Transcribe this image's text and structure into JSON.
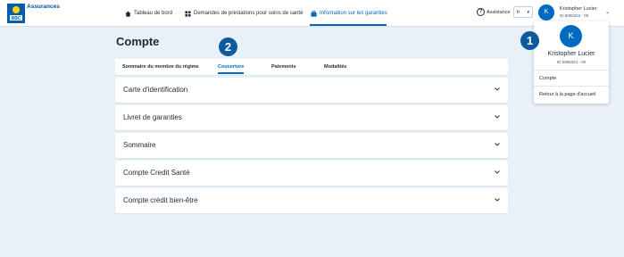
{
  "brand": {
    "name": "Assurances",
    "logo_text": "RBC"
  },
  "nav": {
    "dashboard": "Tableau de bord",
    "claims": "Demandes de prestations pour soins de santé",
    "benefits": "Information sur les garanties"
  },
  "header": {
    "assistance": "Assistance",
    "language": "fr",
    "user_initial": "K",
    "user_name": "Kristopher Lucier",
    "user_id": "ID 6056324 - 00"
  },
  "page": {
    "title": "Compte"
  },
  "tabs": [
    {
      "label": "Sommaire du membre du régime"
    },
    {
      "label": "Couverture",
      "active": true
    },
    {
      "label": "Paiements"
    },
    {
      "label": "Modalités"
    }
  ],
  "accordion": [
    {
      "label": "Carte d'identification"
    },
    {
      "label": "Livret de garanties"
    },
    {
      "label": "Sommaire"
    },
    {
      "label": "Compte Credit Santé"
    },
    {
      "label": "Compte crédit bien-être"
    }
  ],
  "callouts": {
    "one": "1",
    "two": "2"
  },
  "dropdown": {
    "initial": "K",
    "name": "Kristopher Lucier",
    "id": "ID 6056324 - 00",
    "links": [
      "Compte",
      "Retour à la page d'accueil"
    ]
  },
  "colors": {
    "accent": "#006ac3",
    "callout": "#0d5a9e",
    "background": "#e8f1f8"
  }
}
